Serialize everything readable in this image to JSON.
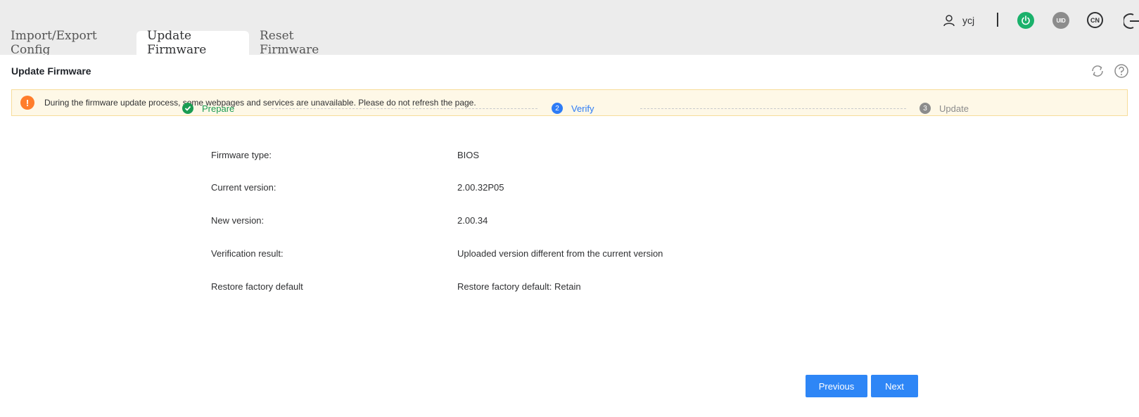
{
  "header": {
    "username": "ycj",
    "uid_label": "UID",
    "lang_label": "CN",
    "icons": [
      "user-icon",
      "power-icon",
      "uid-icon",
      "language-icon",
      "logout-icon"
    ]
  },
  "tabs": [
    {
      "label": "Import/Export Config",
      "active": false
    },
    {
      "label": "Update Firmware",
      "active": true
    },
    {
      "label": "Reset Firmware",
      "active": false
    }
  ],
  "panel": {
    "title": "Update Firmware",
    "alert": {
      "icon": "!",
      "text": "During the firmware update process, some webpages and services are unavailable. Please do not refresh the page."
    },
    "steps": [
      {
        "number": "1",
        "label": "Prepare",
        "state": "done"
      },
      {
        "number": "2",
        "label": "Verify",
        "state": "active"
      },
      {
        "number": "3",
        "label": "Update",
        "state": "pending"
      }
    ],
    "info": [
      {
        "label": "Firmware type:",
        "value": "BIOS"
      },
      {
        "label": "Current version:",
        "value": "2.00.32P05"
      },
      {
        "label": "New version:",
        "value": "2.00.34"
      },
      {
        "label": "Verification result:",
        "value": "Uploaded version different from the current version"
      },
      {
        "label": "Restore factory default",
        "value": "Restore factory default: Retain"
      }
    ],
    "buttons": {
      "previous": "Previous",
      "next": "Next"
    }
  },
  "colors": {
    "primary": "#2e86f6",
    "success": "#1a9c52",
    "warning": "#ff7d2c",
    "alert_bg": "#fef8e7",
    "power": "#1ab16b"
  }
}
